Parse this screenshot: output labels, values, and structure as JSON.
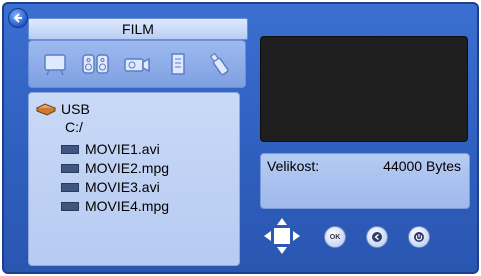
{
  "header": {
    "title": "FILM",
    "back_icon": "back-arrow-icon"
  },
  "categories": [
    {
      "name": "photo-frame-icon"
    },
    {
      "name": "speakers-icon"
    },
    {
      "name": "camcorder-icon"
    },
    {
      "name": "document-icon"
    },
    {
      "name": "usb-stick-icon"
    }
  ],
  "file_browser": {
    "device": "USB",
    "path": "C:/",
    "files": [
      {
        "label": "MOVIE1.avi"
      },
      {
        "label": "MOVIE2.mpg"
      },
      {
        "label": "MOVIE3.avi"
      },
      {
        "label": "MOVIE4.mpg"
      }
    ]
  },
  "info": {
    "label": "Velikost:",
    "value": "44000 Bytes"
  },
  "controls": [
    {
      "name": "dpad-icon"
    },
    {
      "name": "ok-button",
      "label": "OK"
    },
    {
      "name": "back-button"
    },
    {
      "name": "power-button"
    }
  ],
  "colors": {
    "background": "#2f5fbf",
    "panel": "#c9d9f7",
    "preview": "#1e1e1e"
  }
}
